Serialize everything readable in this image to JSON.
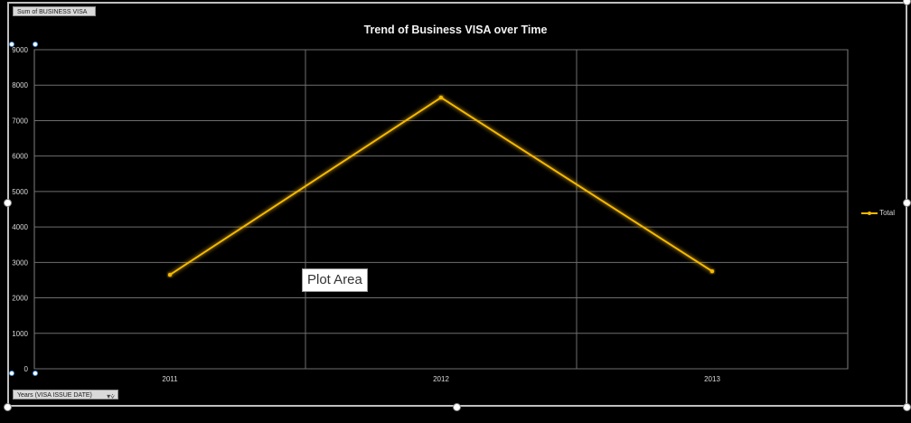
{
  "chart_data": {
    "type": "line",
    "title": "Trend of Business VISA over Time",
    "x": [
      "2011",
      "2012",
      "2013"
    ],
    "series": [
      {
        "name": "Total",
        "values": [
          2650,
          7650,
          2750
        ]
      }
    ],
    "ylim": [
      0,
      9000
    ],
    "yticks": [
      0,
      1000,
      2000,
      3000,
      4000,
      5000,
      6000,
      7000,
      8000,
      9000
    ],
    "xlabel": "",
    "ylabel": "",
    "grid": true,
    "legend_position": "right",
    "line_color": "#f5b800"
  },
  "pivot": {
    "value_field": "Sum of BUSINESS VISA",
    "axis_field": "Years (VISA ISSUE DATE)"
  },
  "tooltip": {
    "text": "Plot Area"
  }
}
